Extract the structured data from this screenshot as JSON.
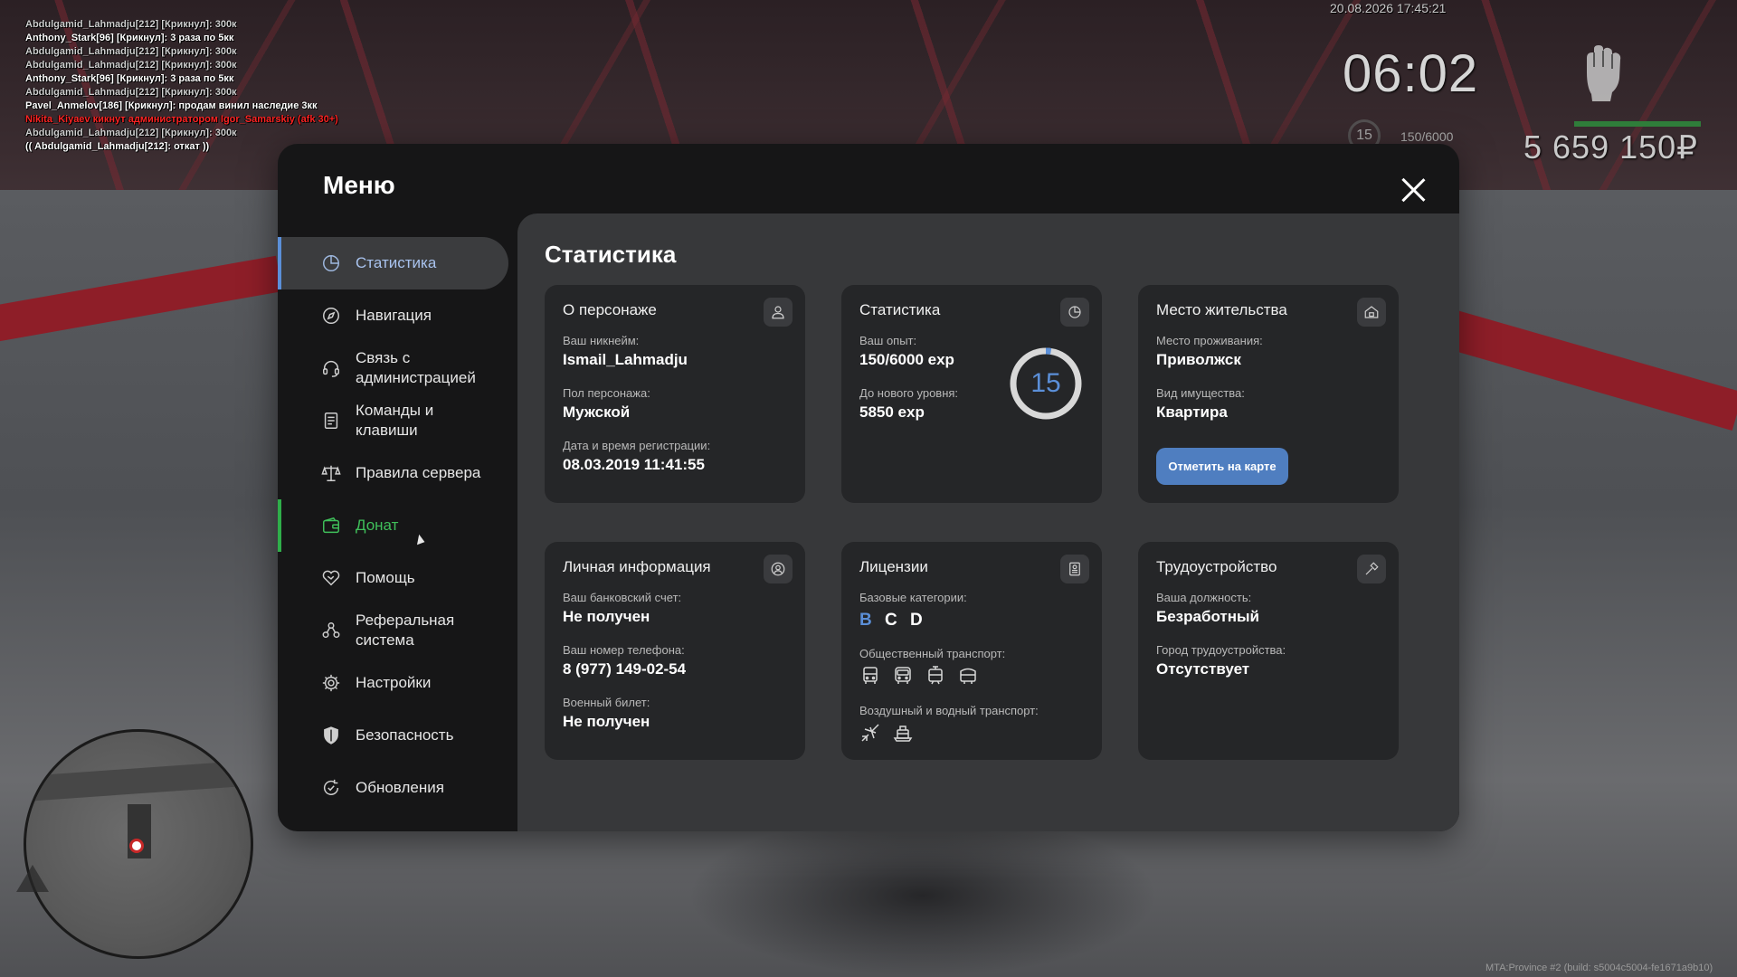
{
  "chat": [
    {
      "text": "Abdulgamid_Lahmadju[212] [Крикнул]: 300к",
      "color": "grey"
    },
    {
      "text": "Anthony_Stark[96] [Крикнул]: 3 раза по 5кк",
      "color": "white"
    },
    {
      "text": "Abdulgamid_Lahmadju[212] [Крикнул]: 300к",
      "color": "grey"
    },
    {
      "text": "Abdulgamid_Lahmadju[212] [Крикнул]: 300к",
      "color": "grey"
    },
    {
      "text": "Anthony_Stark[96] [Крикнул]: 3 раза по 5кк",
      "color": "white"
    },
    {
      "text": "Abdulgamid_Lahmadju[212] [Крикнул]: 300к",
      "color": "grey"
    },
    {
      "text": "Pavel_Anmelov[186] [Крикнул]: продам винил наследие 3кк",
      "color": "white"
    },
    {
      "text": "Nikita_Kiyaev кикнут администратором Igor_Samarskiy (afk 30+)",
      "color": "red"
    },
    {
      "text": "Abdulgamid_Lahmadju[212] [Крикнул]: 300к",
      "color": "grey"
    },
    {
      "text": "(( Abdulgamid_Lahmadju[212]: откат ))",
      "color": "white"
    }
  ],
  "hud": {
    "date": "20.08.2026 17:45:21",
    "time": "06:02",
    "level": "15",
    "exp": "150/6000",
    "money": "5 659 150₽",
    "build": "MTA:Province #2 (build: s5004c5004-fe1671a9b10)"
  },
  "menu": {
    "title": "Меню",
    "content_title": "Статистика",
    "nav": [
      {
        "label": "Статистика",
        "icon": "pie-chart-icon"
      },
      {
        "label": "Навигация",
        "icon": "compass-icon"
      },
      {
        "label": "Связь с администрацией",
        "icon": "headset-icon"
      },
      {
        "label": "Команды и клавиши",
        "icon": "document-icon"
      },
      {
        "label": "Правила сервера",
        "icon": "scales-icon"
      },
      {
        "label": "Донат",
        "icon": "wallet-icon"
      },
      {
        "label": "Помощь",
        "icon": "handshake-icon"
      },
      {
        "label": "Реферальная система",
        "icon": "referral-icon"
      },
      {
        "label": "Настройки",
        "icon": "gear-icon"
      },
      {
        "label": "Безопасность",
        "icon": "shield-icon"
      },
      {
        "label": "Обновления",
        "icon": "refresh-icon"
      }
    ],
    "accent": "#5b8fd8",
    "donate_color": "#3fbf5a"
  },
  "cards": {
    "character": {
      "title": "О персонаже",
      "nick_label": "Ваш никнейм:",
      "nick": "Ismail_Lahmadju",
      "gender_label": "Пол персонажа:",
      "gender": "Мужской",
      "reg_label": "Дата и время регистрации:",
      "reg": "08.03.2019 11:41:55"
    },
    "stats": {
      "title": "Статистика",
      "exp_label": "Ваш опыт:",
      "exp": "150/6000 exp",
      "next_label": "До нового уровня:",
      "next": "5850 exp",
      "level": "15",
      "progress": 0.025
    },
    "residence": {
      "title": "Место жительства",
      "place_label": "Место проживания:",
      "place": "Приволжск",
      "type_label": "Вид имущества:",
      "type": "Квартира",
      "button": "Отметить на карте"
    },
    "personal": {
      "title": "Личная информация",
      "bank_label": "Ваш банковский счет:",
      "bank": "Не получен",
      "phone_label": "Ваш номер телефона:",
      "phone": "8 (977) 149-02-54",
      "military_label": "Военный билет:",
      "military": "Не получен"
    },
    "licenses": {
      "title": "Лицензии",
      "base_label": "Базовые категории:",
      "categories": [
        {
          "name": "B",
          "active": true
        },
        {
          "name": "C",
          "active": false
        },
        {
          "name": "D",
          "active": false
        }
      ],
      "public_label": "Общественный транспорт:",
      "public_icons": [
        "bus-icon",
        "coach-icon",
        "tram-icon",
        "trolleybus-icon"
      ],
      "air_label": "Воздушный и водный транспорт:",
      "air_icons": [
        "airplane-icon",
        "boat-icon"
      ]
    },
    "job": {
      "title": "Трудоустройство",
      "position_label": "Ваша должность:",
      "position": "Безработный",
      "city_label": "Город трудоустройства:",
      "city": "Отсутствует"
    }
  }
}
